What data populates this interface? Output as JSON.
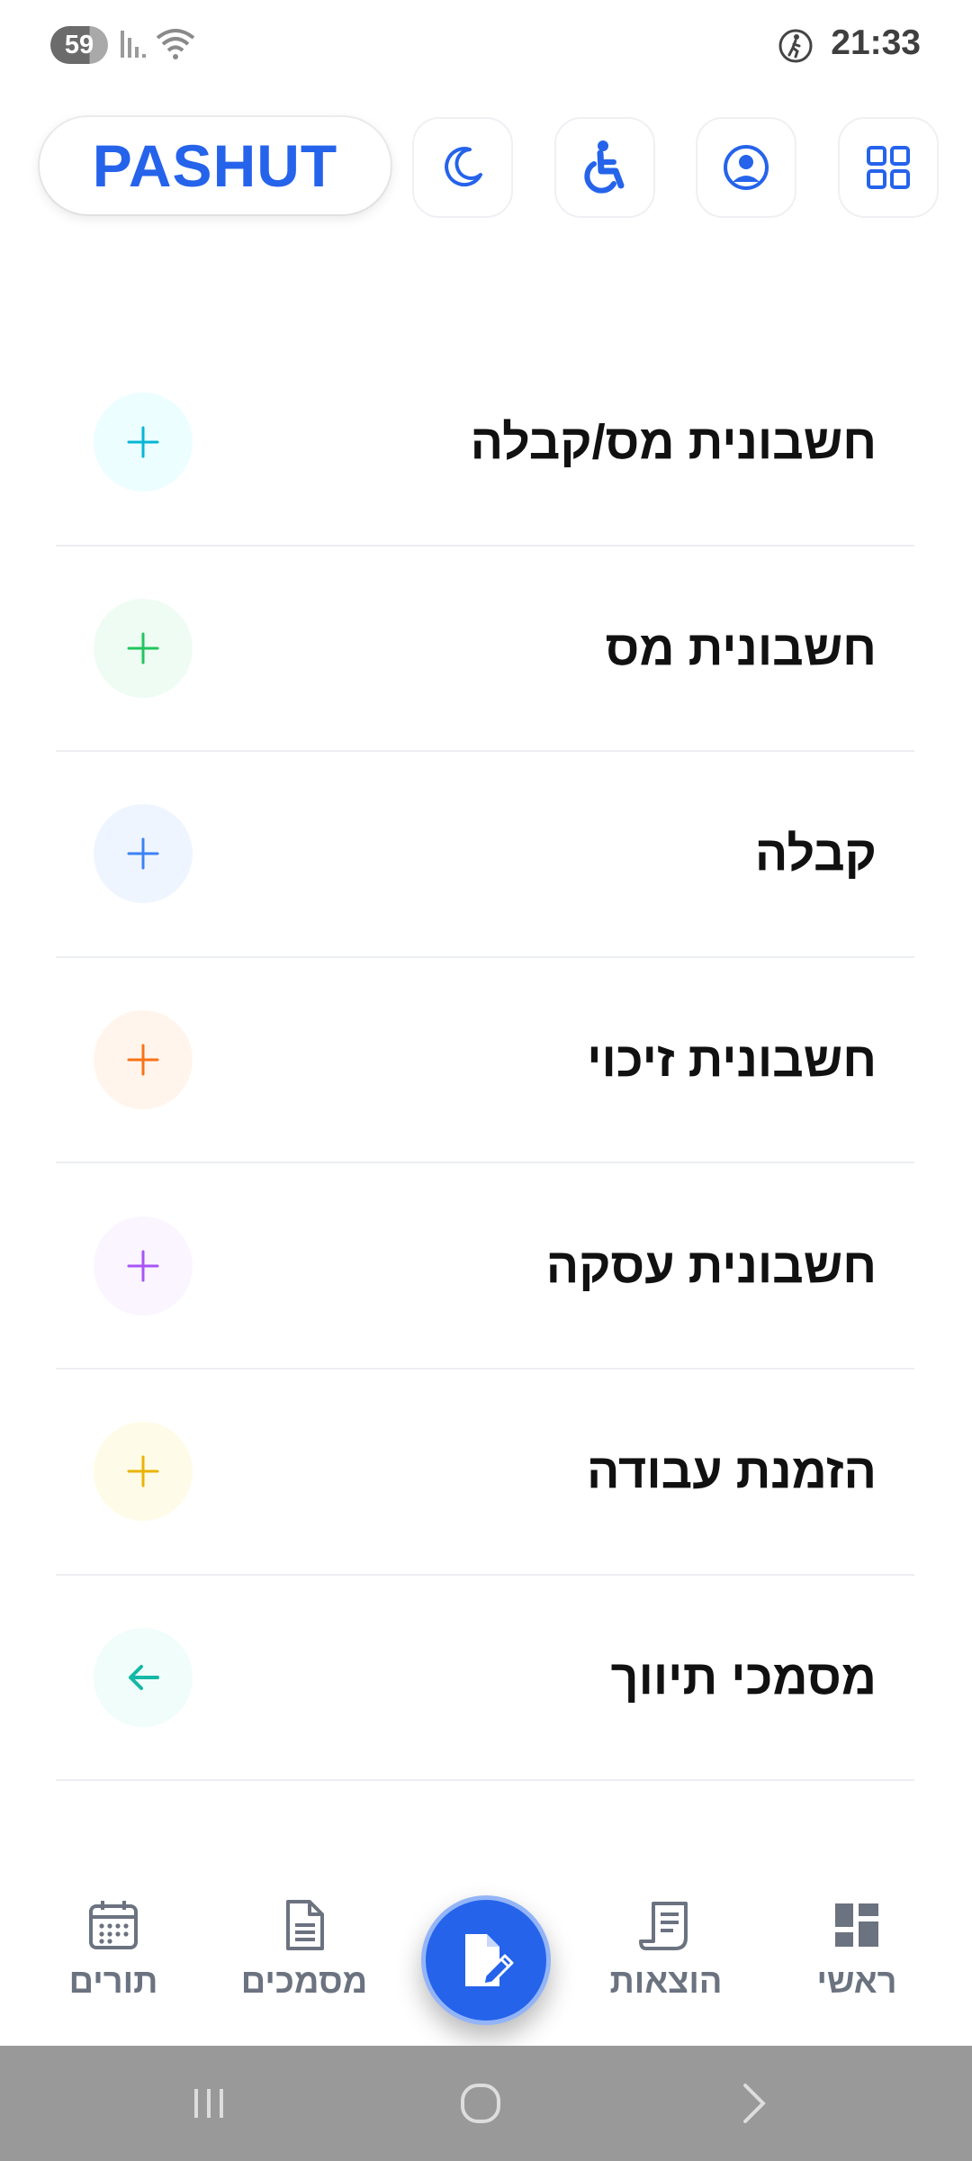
{
  "status_bar": {
    "battery": "59",
    "time": "21:33"
  },
  "header": {
    "brand": "PASHUT",
    "icons": [
      "moon-icon",
      "accessibility-icon",
      "user-circle-icon",
      "grid-icon"
    ]
  },
  "documents": [
    {
      "label": "חשבונית מס/קבלה",
      "icon": "plus-icon",
      "color": "#06b6d4",
      "bg": "#ecfeff"
    },
    {
      "label": "חשבונית מס",
      "icon": "plus-icon",
      "color": "#22c55e",
      "bg": "#effcf3"
    },
    {
      "label": "קבלה",
      "icon": "plus-icon",
      "color": "#3b82f6",
      "bg": "#eff5ff"
    },
    {
      "label": "חשבונית זיכוי",
      "icon": "plus-icon",
      "color": "#f97316",
      "bg": "#fff5ed"
    },
    {
      "label": "חשבונית עסקה",
      "icon": "plus-icon",
      "color": "#a855f7",
      "bg": "#faf5ff"
    },
    {
      "label": "הזמנת עבודה",
      "icon": "plus-icon",
      "color": "#eab308",
      "bg": "#fefce8"
    },
    {
      "label": "מסמכי תיווך",
      "icon": "arrow-left-icon",
      "color": "#14b8a6",
      "bg": "#f0fdfa"
    }
  ],
  "bottom_nav": {
    "items": [
      {
        "label": "תורים",
        "icon": "calendar-icon"
      },
      {
        "label": "מסמכים",
        "icon": "document-icon"
      },
      {
        "label": "הוצאות",
        "icon": "receipt-icon"
      },
      {
        "label": "ראשי",
        "icon": "dashboard-icon"
      }
    ],
    "fab_icon": "document-edit-icon"
  },
  "colors": {
    "accent": "#2563eb",
    "nav_text": "#6b7280"
  }
}
